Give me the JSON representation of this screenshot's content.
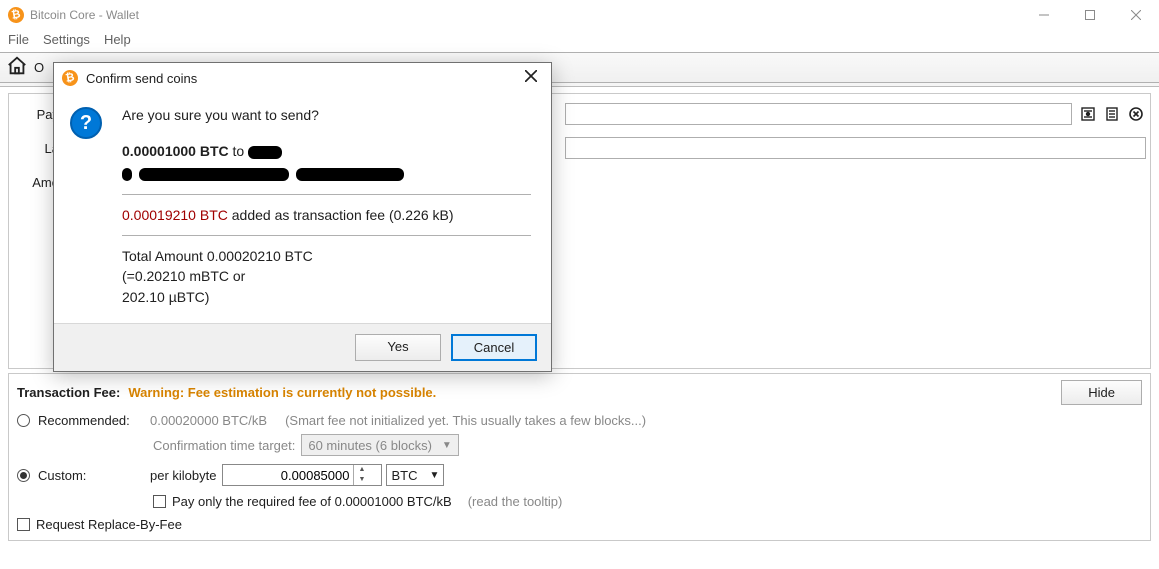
{
  "window": {
    "title": "Bitcoin Core - Wallet",
    "icon_glyph": "₿",
    "menu": {
      "file": "File",
      "settings": "Settings",
      "help": "Help"
    }
  },
  "toolbar": {
    "tab_label_fragment": "O"
  },
  "form": {
    "pay_label": "Pay",
    "label_label": "La",
    "amount_label": "Amo"
  },
  "dialog": {
    "title": "Confirm send coins",
    "icon_glyph": "₿",
    "question": "Are you sure you want to send?",
    "send_amount": "0.00001000 BTC",
    "to_word": " to",
    "fee_amount": "0.00019210 BTC",
    "fee_rest": " added as transaction fee (0.226 kB)",
    "total_line": "Total Amount 0.00020210 BTC",
    "conv1": "(=0.20210 mBTC or",
    "conv2": "202.10 µBTC)",
    "yes": "Yes",
    "cancel": "Cancel"
  },
  "fee": {
    "label": "Transaction Fee:",
    "warning": "Warning: Fee estimation is currently not possible.",
    "hide": "Hide",
    "recommended": "Recommended:",
    "rec_value": "0.00020000 BTC/kB",
    "rec_note": "(Smart fee not initialized yet. This usually takes a few blocks...)",
    "conf_target_label": "Confirmation time target:",
    "conf_target_value": "60 minutes (6 blocks)",
    "custom": "Custom:",
    "per_kb": "per kilobyte",
    "custom_value": "0.00085000",
    "unit": "BTC",
    "pay_only_label": "Pay only the required fee of 0.00001000 BTC/kB",
    "tooltip": "(read the tooltip)",
    "rbf": "Request Replace-By-Fee"
  }
}
